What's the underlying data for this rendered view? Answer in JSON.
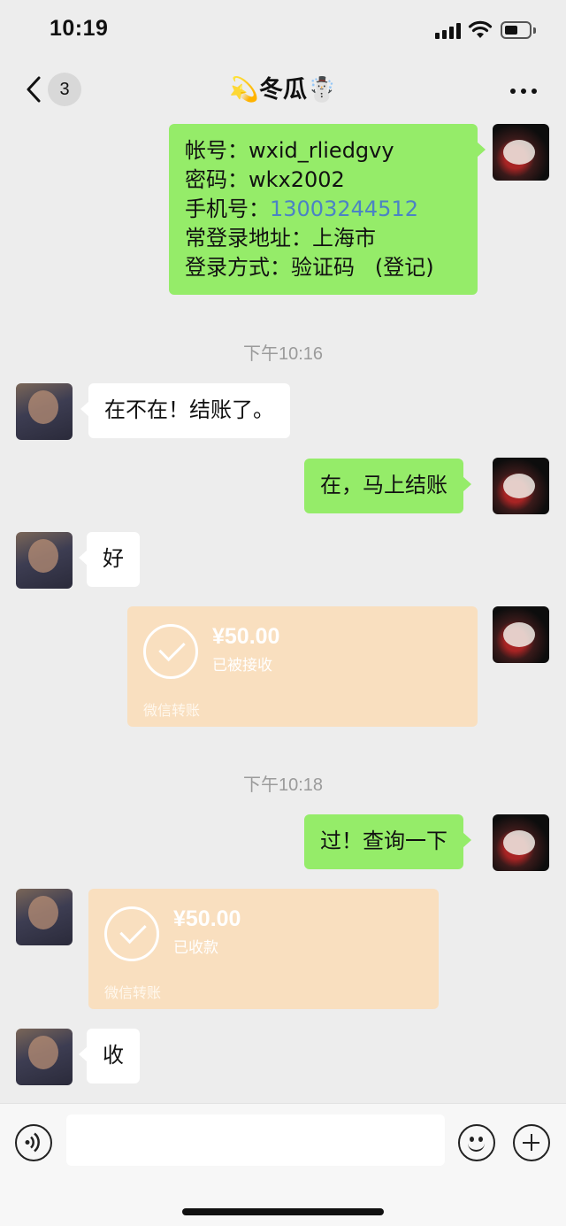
{
  "status_bar": {
    "time": "10:19"
  },
  "nav": {
    "unread_count": "3",
    "title": "💫冬瓜☃️"
  },
  "messages": {
    "account_info": {
      "line1": "帐号：wxid_rliedgvy",
      "line2": "密码：wkx2002",
      "line3_label": "手机号：",
      "line3_phone": "13003244512",
      "line4": "常登录地址：上海市",
      "line5": "登录方式：验证码   (登记)"
    },
    "timestamp1": "下午10:16",
    "msg1": "在不在！结账了。",
    "msg2": "在，马上结账",
    "msg3": "好",
    "transfer1": {
      "amount": "¥50.00",
      "status": "已被接收",
      "label": "微信转账"
    },
    "timestamp2": "下午10:18",
    "msg4": "过！查询一下",
    "transfer2": {
      "amount": "¥50.00",
      "status": "已收款",
      "label": "微信转账"
    },
    "msg5": "收"
  },
  "input_bar": {
    "placeholder": ""
  },
  "colors": {
    "self_bubble": "#95ec69",
    "other_bubble": "#ffffff",
    "transfer": "#f9dfbf",
    "background": "#ededed"
  }
}
